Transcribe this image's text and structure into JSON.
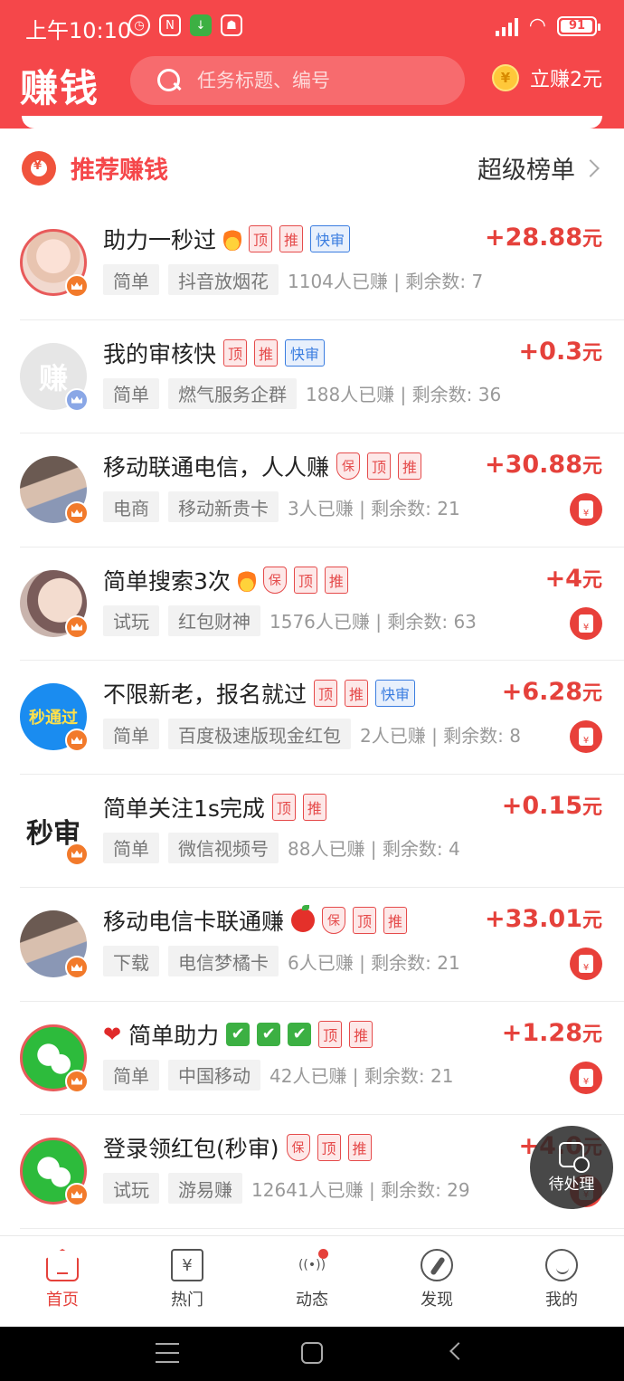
{
  "status_bar": {
    "time": "上午10:10",
    "battery": "91"
  },
  "header": {
    "brand": "赚钱",
    "search_placeholder": "任务标题、编号",
    "earn_label": "立赚2元",
    "coin_symbol": "¥"
  },
  "section": {
    "title": "推荐赚钱",
    "ranking_label": "超级榜单"
  },
  "tasks": [
    {
      "title": "助力一秒过",
      "emoji": "fire",
      "guarantee": false,
      "tags": [
        "顶",
        "推"
      ],
      "fast": "快审",
      "price": "+28.88",
      "unit": "元",
      "category": "简单",
      "keyword": "抖音放烟花",
      "stats": "1104人已赚 | 剩余数: 7",
      "redpacket": false,
      "avatar": "photo-pink",
      "avatar_text": ""
    },
    {
      "title": "我的审核快",
      "emoji": "",
      "guarantee": false,
      "tags": [
        "顶",
        "推"
      ],
      "fast": "快审",
      "price": "+0.3",
      "unit": "元",
      "category": "简单",
      "keyword": "燃气服务企群",
      "stats": "188人已赚 | 剩余数: 36",
      "redpacket": false,
      "avatar": "gray",
      "avatar_text": "赚"
    },
    {
      "title": "移动联通电信，人人赚",
      "emoji": "",
      "guarantee": true,
      "tags": [
        "顶",
        "推"
      ],
      "fast": "",
      "price": "+30.88",
      "unit": "元",
      "category": "电商",
      "keyword": "移动新贵卡",
      "stats": "3人已赚 | 剩余数: 21",
      "redpacket": true,
      "avatar": "photo-room",
      "avatar_text": ""
    },
    {
      "title": "简单搜索3次",
      "emoji": "fire",
      "guarantee": true,
      "tags": [
        "顶",
        "推"
      ],
      "fast": "",
      "price": "+4",
      "unit": "元",
      "category": "试玩",
      "keyword": "红包财神",
      "stats": "1576人已赚 | 剩余数: 63",
      "redpacket": true,
      "avatar": "photo-face",
      "avatar_text": ""
    },
    {
      "title": "不限新老，报名就过",
      "emoji": "",
      "guarantee": false,
      "tags": [
        "顶",
        "推"
      ],
      "fast": "快审",
      "price": "+6.28",
      "unit": "元",
      "category": "简单",
      "keyword": "百度极速版现金红包",
      "stats": "2人已赚 | 剩余数: 8",
      "redpacket": true,
      "avatar": "blue",
      "avatar_text": "秒通过"
    },
    {
      "title": "简单关注1s完成",
      "emoji": "",
      "guarantee": false,
      "tags": [
        "顶",
        "推"
      ],
      "fast": "",
      "price": "+0.15",
      "unit": "元",
      "category": "简单",
      "keyword": "微信视频号",
      "stats": "88人已赚 | 剩余数: 4",
      "redpacket": false,
      "avatar": "text",
      "avatar_text": "秒审"
    },
    {
      "title": "移动电信卡联通赚",
      "emoji": "apple",
      "guarantee": true,
      "tags": [
        "顶",
        "推"
      ],
      "fast": "",
      "price": "+33.01",
      "unit": "元",
      "category": "下载",
      "keyword": "电信梦橘卡",
      "stats": "6人已赚 | 剩余数: 21",
      "redpacket": true,
      "avatar": "photo-room",
      "avatar_text": ""
    },
    {
      "title": "简单助力",
      "emoji": "heart-checks",
      "guarantee": false,
      "tags": [
        "顶",
        "推"
      ],
      "fast": "",
      "price": "+1.28",
      "unit": "元",
      "category": "简单",
      "keyword": "中国移动",
      "stats": "42人已赚 | 剩余数: 21",
      "redpacket": true,
      "avatar": "wechat",
      "avatar_text": ""
    },
    {
      "title": "登录领红包(秒审)",
      "emoji": "",
      "guarantee": true,
      "tags": [
        "顶",
        "推"
      ],
      "fast": "",
      "price": "+4.0",
      "unit": "元",
      "category": "试玩",
      "keyword": "游易赚",
      "stats": "12641人已赚 | 剩余数: 29",
      "redpacket": true,
      "avatar": "wechat",
      "avatar_text": ""
    }
  ],
  "guarantee_label": "保",
  "floating_button": {
    "label": "待处理"
  },
  "tabbar": [
    {
      "label": "首页",
      "icon": "home-icon",
      "active": true
    },
    {
      "label": "热门",
      "icon": "ticket-icon",
      "active": false
    },
    {
      "label": "动态",
      "icon": "broadcast-icon",
      "active": false
    },
    {
      "label": "发现",
      "icon": "compass-icon",
      "active": false
    },
    {
      "label": "我的",
      "icon": "user-icon",
      "active": false
    }
  ],
  "colors": {
    "brand_red": "#f5474a",
    "price_red": "#e5413b",
    "tag_blue": "#3a7de0"
  }
}
